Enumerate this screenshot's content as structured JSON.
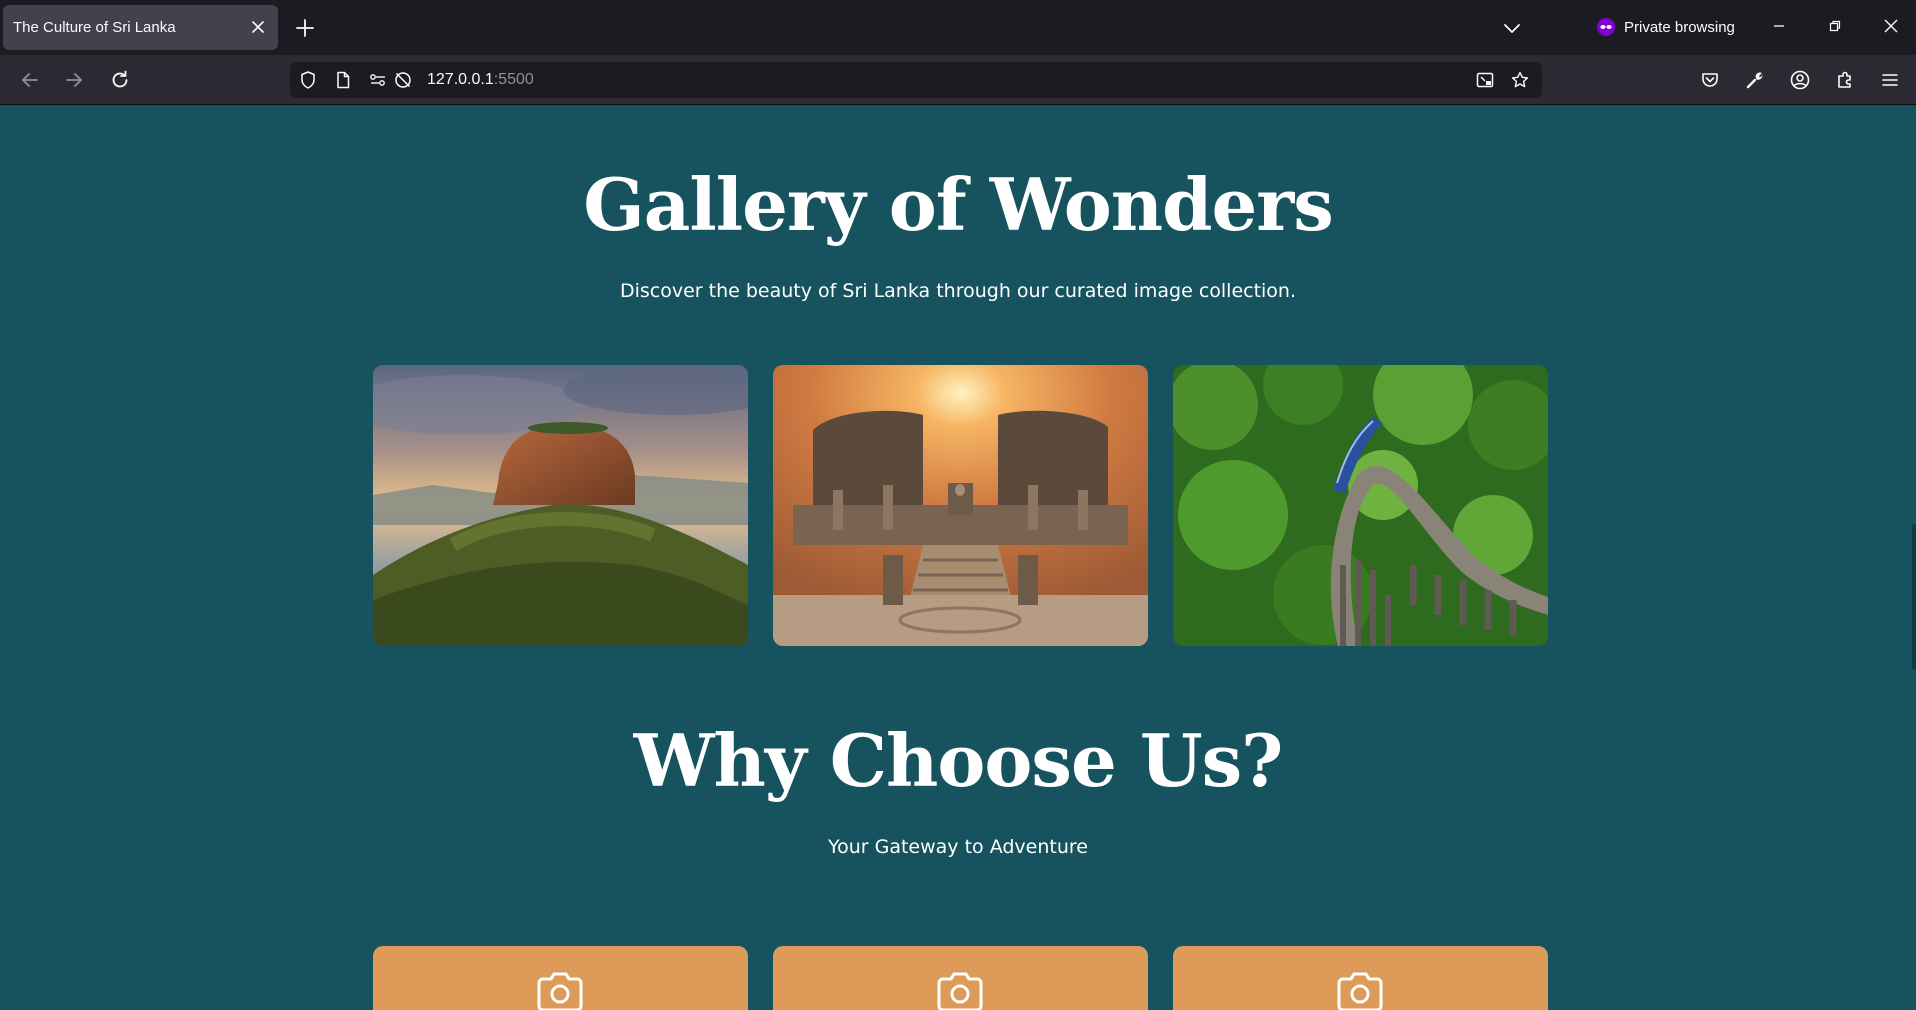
{
  "browser": {
    "tab_title": "The Culture of Sri Lanka",
    "private_label": "Private browsing",
    "url_host": "127.0.0.1",
    "url_port": ":5500"
  },
  "gallery": {
    "title": "Gallery of Wonders",
    "subtitle": "Discover the beauty of Sri Lanka through our curated image collection.",
    "images": [
      {
        "subject": "sigiriya-rock"
      },
      {
        "subject": "ancient-temple-ruins"
      },
      {
        "subject": "train-on-bridge"
      }
    ]
  },
  "why": {
    "title": "Why Choose Us?",
    "subtitle": "Your Gateway to Adventure",
    "cards": [
      {
        "icon": "camera-icon"
      },
      {
        "icon": "camera-icon"
      },
      {
        "icon": "camera-icon"
      }
    ]
  },
  "colors": {
    "page_bg": "#16535f",
    "card_bg": "#dd9a58",
    "private_accent": "#8000d7"
  }
}
